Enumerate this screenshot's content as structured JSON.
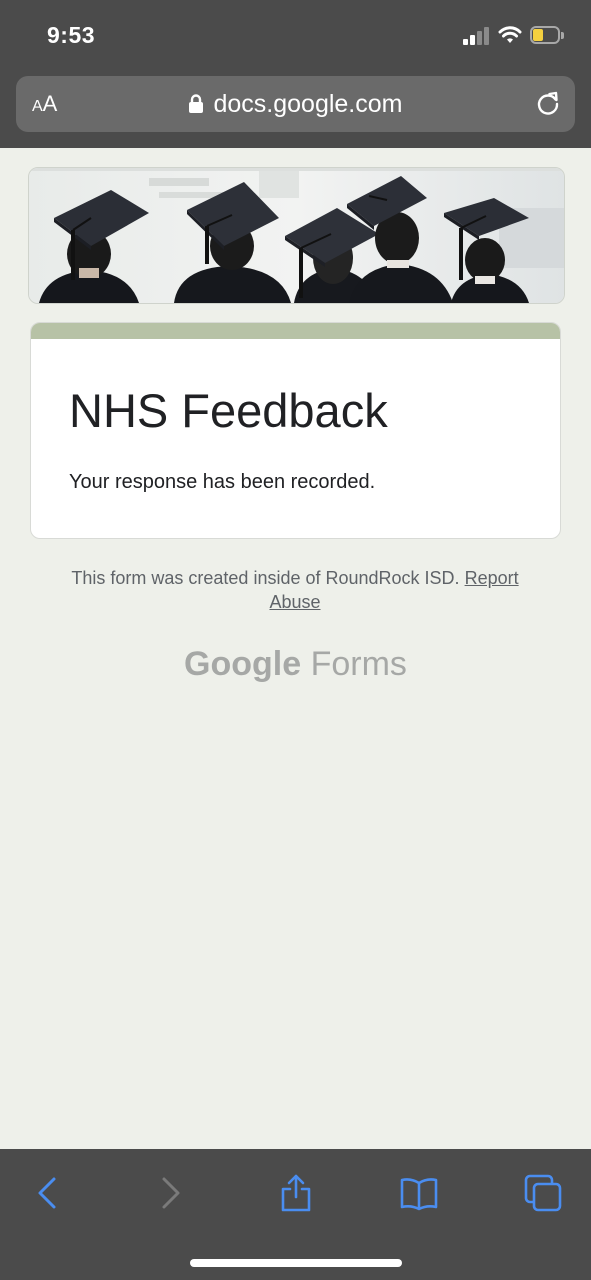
{
  "status_bar": {
    "time": "9:53",
    "battery_color": "#f4d03f"
  },
  "browser": {
    "text_size_small": "A",
    "text_size_big": "A",
    "url": "docs.google.com"
  },
  "form": {
    "accent_color": "#b7c2a6",
    "title": "NHS Feedback",
    "confirmation": "Your response has been recorded."
  },
  "footer": {
    "note": "This form was created inside of RoundRock ISD.",
    "report_link": "Report Abuse"
  },
  "brand": {
    "google": "Google",
    "product": "Forms"
  },
  "toolbar": {
    "active_color": "#4a8df0",
    "disabled_color": "#7a7a7a",
    "icons": [
      "back-icon",
      "forward-icon",
      "share-icon",
      "bookmarks-icon",
      "tabs-icon"
    ]
  }
}
